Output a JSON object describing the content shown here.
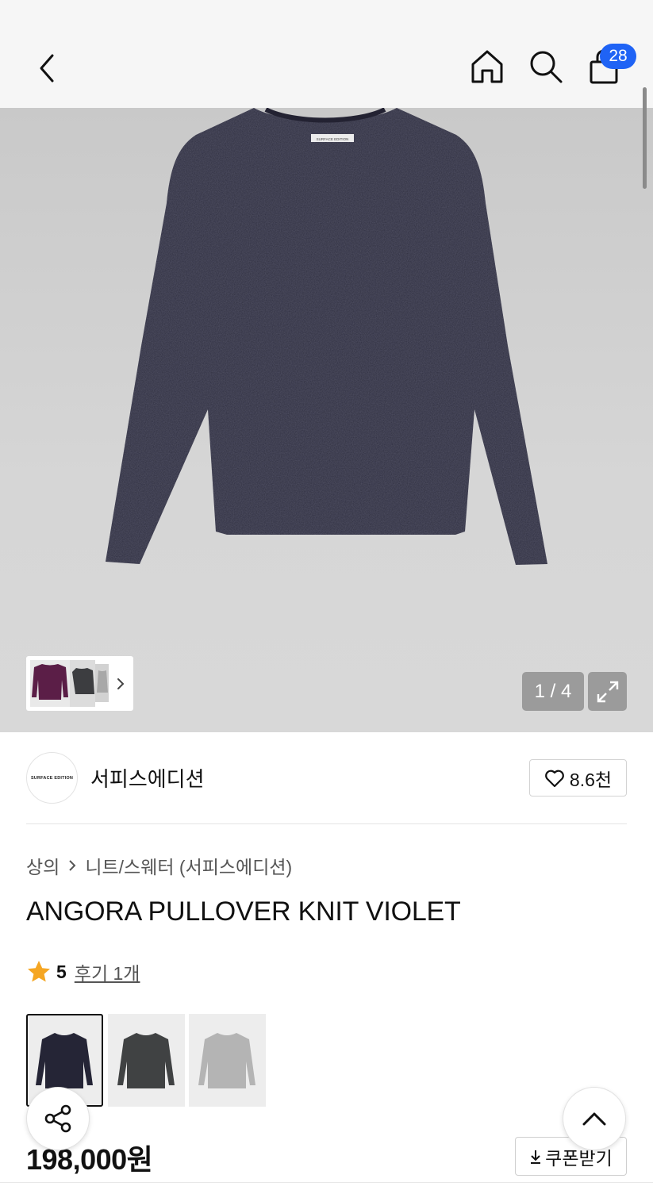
{
  "header": {
    "back_icon": "chevron-left-icon",
    "home_icon": "home-icon",
    "search_icon": "search-icon",
    "cart_icon": "shopping-bag-icon",
    "cart_count": "28",
    "badge_color": "#1f63f5"
  },
  "gallery": {
    "counter": "1 / 4",
    "expand_icon": "expand-icon",
    "product_color": "#2b2a3c",
    "neck_label_text": "SURFACE EDITION",
    "thumb_colors": [
      "#5b1e47",
      "#3c3d40",
      "#a8a8a8"
    ]
  },
  "brand": {
    "logo_text": "SURFACE EDITION",
    "name": "서피스에디션",
    "likes": "8.6천"
  },
  "product": {
    "breadcrumb": [
      "상의",
      "니트/스웨터 (서피스에디션)"
    ],
    "title": "ANGORA PULLOVER KNIT VIOLET",
    "rating": "5",
    "review_link": "후기 1개",
    "star_color": "#f5a623",
    "variant_colors": [
      "#252536",
      "#404243",
      "#b4b4b4"
    ],
    "price": "198,000원",
    "coupon_label": "쿠폰받기"
  },
  "floating": {
    "share_icon": "share-icon",
    "top_icon": "chevron-up-icon"
  }
}
